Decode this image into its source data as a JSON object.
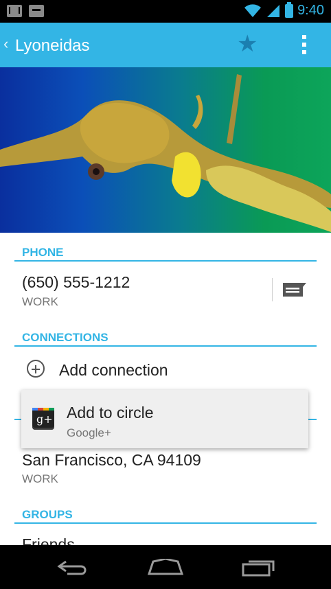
{
  "status_bar": {
    "time": "9:40"
  },
  "action_bar": {
    "back_glyph": "‹",
    "title": "Lyoneidas"
  },
  "sections": {
    "phone": {
      "header": "PHONE",
      "number": "(650) 555-1212",
      "type": "WORK"
    },
    "connections": {
      "header": "CONNECTIONS",
      "add_label": "Add connection"
    },
    "address": {
      "value": "San Francisco, CA 94109",
      "type": "WORK"
    },
    "groups": {
      "header": "GROUPS",
      "first_item": "Friends"
    }
  },
  "popup": {
    "title": "Add to circle",
    "subtitle": "Google+",
    "icon_text": "g+"
  },
  "colors": {
    "accent": "#33b5e5",
    "status_bar": "#000000",
    "nav_bar": "#000000"
  },
  "icons": {
    "status_left": [
      "gmail-icon",
      "chat-icon"
    ],
    "status_right": [
      "wifi-icon",
      "signal-icon",
      "battery-icon"
    ],
    "action": [
      "star-icon",
      "overflow-menu-icon"
    ],
    "nav": [
      "back-icon",
      "home-icon",
      "recent-apps-icon"
    ]
  }
}
